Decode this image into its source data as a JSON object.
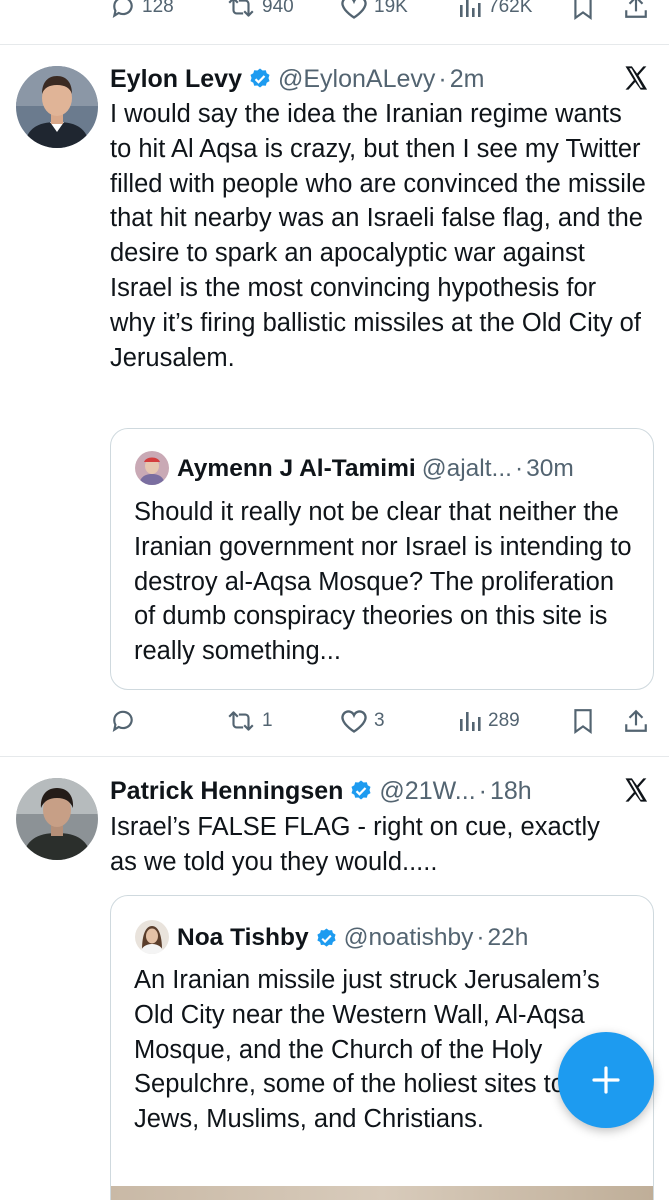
{
  "top_actions": {
    "replies": "128",
    "reposts": "940",
    "likes": "19K",
    "views": "762K"
  },
  "tweets": [
    {
      "name": "Eylon Levy",
      "handle": "@EylonALevy",
      "time": "2m",
      "text": "I would say the idea the Iranian regime wants to hit Al Aqsa is crazy, but then I see my Twitter filled with people who are convinced the missile that hit nearby was an Israeli false flag, and the desire to spark an apocalyptic war against Israel is the most convincing hypothesis for why it’s firing ballistic missiles at the Old City of Jerusalem.",
      "quote": {
        "name": "Aymenn J Al-Tamimi",
        "handle": "@ajalt...",
        "time": "30m",
        "text": "Should it really not be clear that neither the Iranian government nor Israel is intending to destroy al-Aqsa Mosque? The proliferation of dumb conspiracy theories on this site is really something..."
      },
      "actions": {
        "replies": "",
        "reposts": "1",
        "likes": "3",
        "views": "289"
      }
    },
    {
      "name": "Patrick Henningsen",
      "handle": "@21W...",
      "time": "18h",
      "text": "Israel’s FALSE FLAG - right on cue, exactly as we told you they would.....",
      "quote": {
        "name": "Noa Tishby",
        "handle": "@noatishby",
        "time": "22h",
        "text": "An Iranian missile just struck Jerusalem’s Old City near the Western Wall, Al-Aqsa Mosque, and the Church of the Holy Sepulchre, some of the holiest sites to Jews, Muslims, and Christians."
      }
    }
  ],
  "separator": "·",
  "colors": {
    "accent": "#1d9bf0",
    "text": "#0f1419",
    "muted": "#536471",
    "border": "#cfd9de"
  },
  "icons": [
    "reply-icon",
    "repost-icon",
    "like-icon",
    "views-icon",
    "bookmark-icon",
    "share-icon",
    "verified-badge-icon",
    "x-logo-icon",
    "compose-plus-icon"
  ]
}
